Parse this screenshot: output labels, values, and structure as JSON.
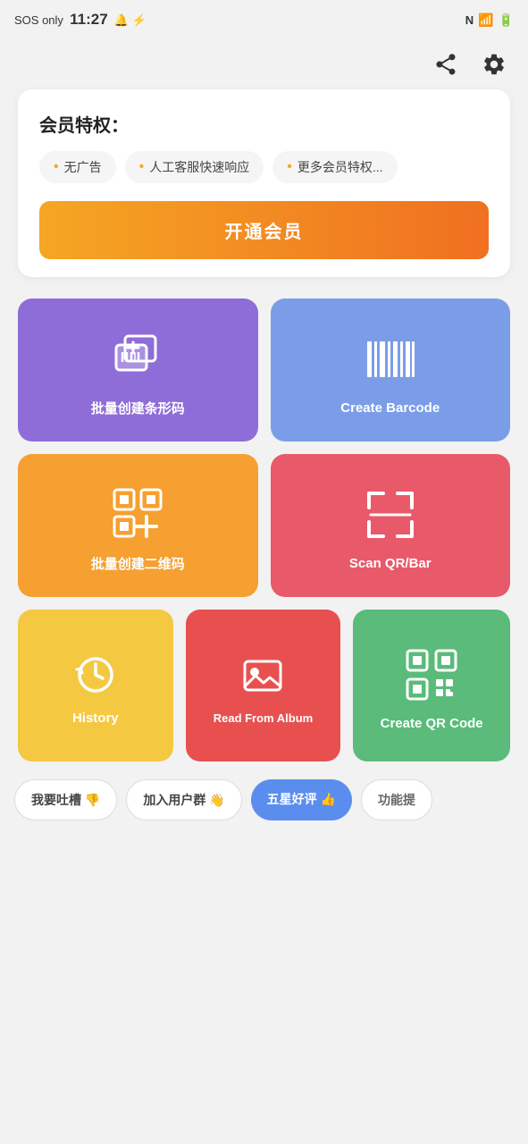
{
  "statusBar": {
    "left": "SOS only",
    "time": "11:27",
    "icons": [
      "🔔",
      "⚡",
      "N",
      "||",
      "📶",
      "🔋"
    ]
  },
  "topBar": {
    "shareLabel": "share",
    "settingsLabel": "settings"
  },
  "membershipCard": {
    "title": "会员特权：",
    "tags": [
      "无广告",
      "人工客服快速响应",
      "更多会员特权..."
    ],
    "buttonLabel": "开通会员"
  },
  "gridCards": {
    "row1": [
      {
        "id": "batch-barcode",
        "label": "批量创建条形码",
        "color": "card-purple"
      },
      {
        "id": "create-barcode",
        "label": "Create Barcode",
        "color": "card-blue"
      }
    ],
    "row2": [
      {
        "id": "batch-qr",
        "label": "批量创建二维码",
        "color": "card-orange"
      },
      {
        "id": "scan-qr",
        "label": "Scan QR/Bar",
        "color": "card-red"
      }
    ],
    "row3": [
      {
        "id": "history",
        "label": "History",
        "color": "card-yellow",
        "size": "small"
      },
      {
        "id": "read-album",
        "label": "Read From Album",
        "color": "card-pinkred",
        "size": "small"
      },
      {
        "id": "create-qr",
        "label": "Create QR Code",
        "color": "card-green",
        "size": "large"
      }
    ]
  },
  "bottomTabs": [
    {
      "id": "complaint",
      "label": "我要吐槽 👎",
      "style": "outline"
    },
    {
      "id": "join-group",
      "label": "加入用户群 👋",
      "style": "outline"
    },
    {
      "id": "five-star",
      "label": "五星好评 👍",
      "style": "blue"
    },
    {
      "id": "suggest",
      "label": "功能提",
      "style": "outline-gray"
    }
  ]
}
